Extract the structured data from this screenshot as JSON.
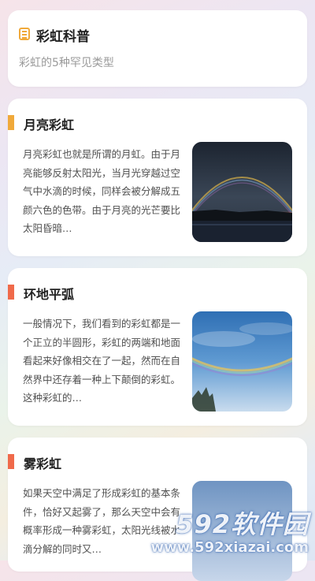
{
  "header": {
    "icon": "document-icon",
    "title": "彩虹科普",
    "subtitle": "彩虹的5种罕见类型"
  },
  "items": [
    {
      "title": "月亮彩虹",
      "accent": "#f0a93a",
      "text": "月亮彩虹也就是所谓的月虹。由于月亮能够反射太阳光，当月光穿越过空气中水滴的时候，同样会被分解成五颜六色的色带。由于月亮的光芒要比太阳昏暗…"
    },
    {
      "title": "环地平弧",
      "accent": "#f06a4a",
      "text": "一般情况下，我们看到的彩虹都是一个正立的半圆形，彩虹的两端和地面看起来好像相交在了一起，然而在自然界中还存着一种上下颠倒的彩虹。这种彩虹的…"
    },
    {
      "title": "雾彩虹",
      "accent": "#f06a4a",
      "text": "如果天空中满足了形成彩虹的基本条件，恰好又起雾了，那么天空中会有概率形成一种雾彩虹，太阳光线被水滴分解的同时又…"
    }
  ],
  "watermark": {
    "logo": "592软件园",
    "url": "www.592xiazai.com"
  }
}
